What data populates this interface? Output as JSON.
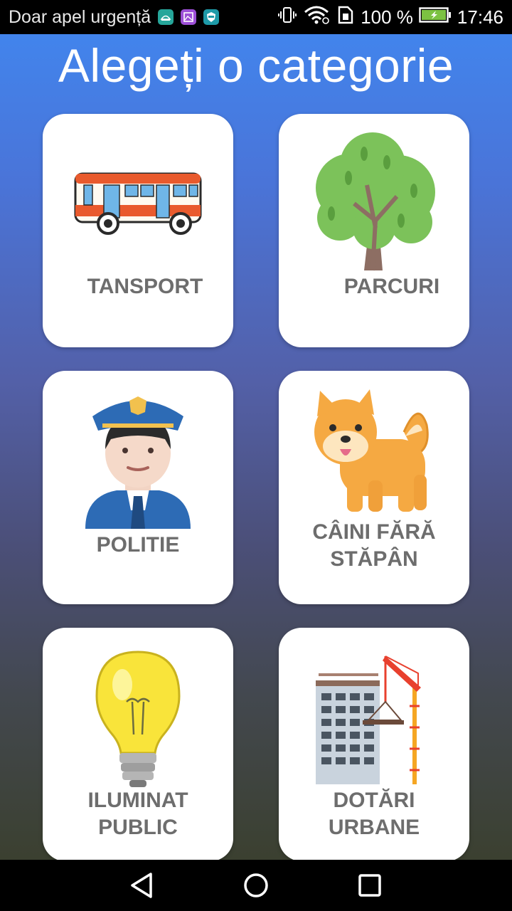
{
  "status_bar": {
    "carrier": "Doar apel urgență",
    "battery": "100 %",
    "time": "17:46",
    "icons": [
      "android-debug-icon",
      "gallery-icon",
      "shield-app-icon",
      "vibrate-icon",
      "wifi-icon",
      "data-sim-icon",
      "battery-charging-icon"
    ]
  },
  "page": {
    "title": "Alegeți o categorie"
  },
  "categories": [
    {
      "label": "TANSPORT",
      "icon": "bus-icon"
    },
    {
      "label": "PARCURI",
      "icon": "tree-icon"
    },
    {
      "label": "POLITIE",
      "icon": "police-officer-icon"
    },
    {
      "label_line1": "CÂINI FĂRĂ",
      "label_line2": "STĂPÂN",
      "icon": "dog-icon"
    },
    {
      "label_line1": "ILUMINAT",
      "label_line2": "PUBLIC",
      "icon": "light-bulb-icon"
    },
    {
      "label_line1": "DOTĂRI",
      "label_line2": "URBANE",
      "icon": "construction-icon"
    }
  ],
  "nav_bar": {
    "icons": [
      "back-icon",
      "home-icon",
      "recents-icon"
    ]
  },
  "colors": {
    "gradient_top": "#4284ec",
    "gradient_bottom": "#3b4030",
    "tile_bg": "#ffffff",
    "label_gray": "#6d6d6d"
  }
}
